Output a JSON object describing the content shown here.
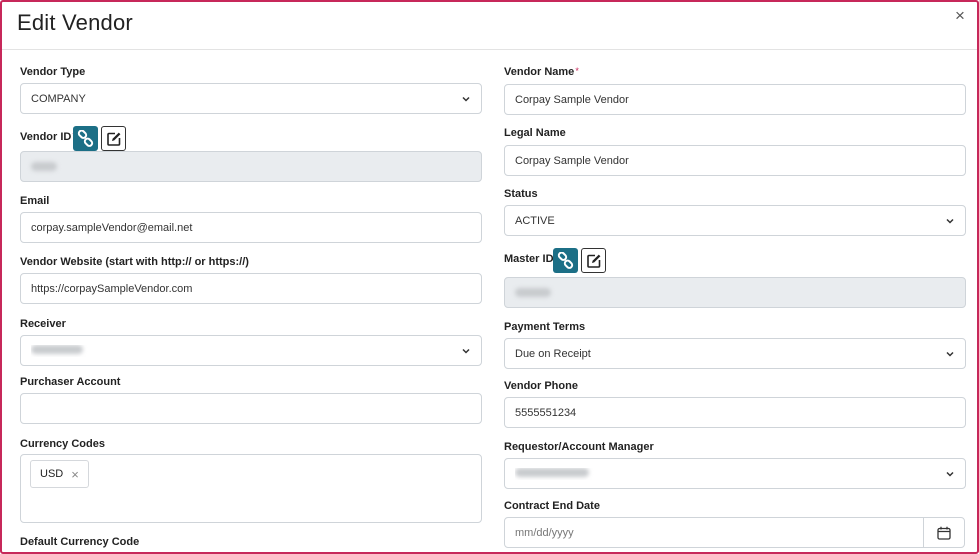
{
  "modal": {
    "title": "Edit Vendor",
    "close_glyph": "×"
  },
  "left": {
    "vendor_type": {
      "label": "Vendor Type",
      "value": "COMPANY"
    },
    "vendor_id": {
      "label": "Vendor ID",
      "required_mark": "*",
      "link_icon": "link-icon",
      "edit_icon": "edit-icon"
    },
    "email": {
      "label": "Email",
      "value": "corpay.sampleVendor@email.net"
    },
    "website": {
      "label": "Vendor Website (start with http:// or https://)",
      "value": "https://corpaySampleVendor.com"
    },
    "receiver": {
      "label": "Receiver"
    },
    "purchaser_account": {
      "label": "Purchaser Account",
      "value": ""
    },
    "currency_codes": {
      "label": "Currency Codes",
      "tags": [
        "USD"
      ],
      "remove_glyph": "×"
    },
    "default_currency": {
      "label": "Default Currency Code"
    }
  },
  "right": {
    "vendor_name": {
      "label": "Vendor Name",
      "required_mark": "*",
      "value": "Corpay Sample Vendor"
    },
    "legal_name": {
      "label": "Legal Name",
      "value": "Corpay Sample Vendor"
    },
    "status": {
      "label": "Status",
      "value": "ACTIVE"
    },
    "master_id": {
      "label": "Master ID",
      "link_icon": "link-icon",
      "edit_icon": "edit-icon"
    },
    "payment_terms": {
      "label": "Payment Terms",
      "value": "Due on Receipt"
    },
    "vendor_phone": {
      "label": "Vendor Phone",
      "value": "5555551234"
    },
    "requestor": {
      "label": "Requestor/Account Manager"
    },
    "contract_end_date": {
      "label": "Contract End Date",
      "placeholder": "mm/dd/yyyy",
      "calendar_icon": "calendar-icon"
    }
  },
  "colors": {
    "accent_border": "#c7285a",
    "teal_button": "#1c6f86",
    "disabled_bg": "#e9ecef"
  }
}
